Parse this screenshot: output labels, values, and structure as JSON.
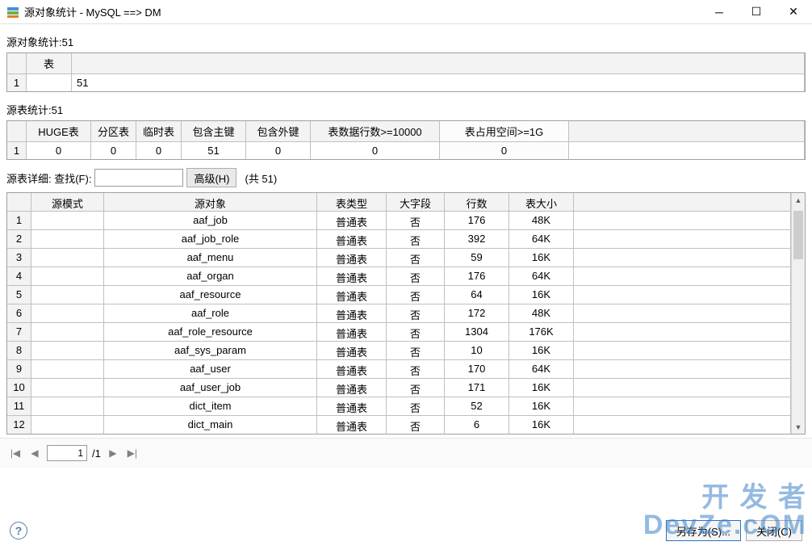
{
  "title": "源对象统计 - MySQL     ==>   DM",
  "section1": {
    "label": "源对象统计:51",
    "head": "表",
    "row": "1",
    "value": "51"
  },
  "section2": {
    "label": "源表统计:51",
    "headers": [
      "HUGE表",
      "分区表",
      "临时表",
      "包含主键",
      "包含外键",
      "表数据行数>=10000",
      "表占用空间>=1G"
    ],
    "row": "1",
    "values": [
      "0",
      "0",
      "0",
      "51",
      "0",
      "0",
      "0"
    ]
  },
  "search": {
    "label": "源表详细: 查找(F):",
    "adv": "高级(H)",
    "total": "(共 51)"
  },
  "grid3": {
    "headers": [
      "源模式",
      "源对象",
      "表类型",
      "大字段",
      "行数",
      "表大小"
    ],
    "rows": [
      [
        "1",
        "",
        "aaf_job",
        "普通表",
        "否",
        "176",
        "48K"
      ],
      [
        "2",
        "",
        "aaf_job_role",
        "普通表",
        "否",
        "392",
        "64K"
      ],
      [
        "3",
        "",
        "aaf_menu",
        "普通表",
        "否",
        "59",
        "16K"
      ],
      [
        "4",
        "",
        "aaf_organ",
        "普通表",
        "否",
        "176",
        "64K"
      ],
      [
        "5",
        "",
        "aaf_resource",
        "普通表",
        "否",
        "64",
        "16K"
      ],
      [
        "6",
        "",
        "aaf_role",
        "普通表",
        "否",
        "172",
        "48K"
      ],
      [
        "7",
        "",
        "aaf_role_resource",
        "普通表",
        "否",
        "1304",
        "176K"
      ],
      [
        "8",
        "",
        "aaf_sys_param",
        "普通表",
        "否",
        "10",
        "16K"
      ],
      [
        "9",
        "",
        "aaf_user",
        "普通表",
        "否",
        "170",
        "64K"
      ],
      [
        "10",
        "",
        "aaf_user_job",
        "普通表",
        "否",
        "171",
        "16K"
      ],
      [
        "11",
        "",
        "dict_item",
        "普通表",
        "否",
        "52",
        "16K"
      ],
      [
        "12",
        "",
        "dict_main",
        "普通表",
        "否",
        "6",
        "16K"
      ]
    ]
  },
  "pager": {
    "page": "1",
    "total": "/1"
  },
  "footer": {
    "saveAs": "另存为(S)...",
    "close": "关闭(C)"
  },
  "watermark": "开 发 者\nDevZe.cOM"
}
